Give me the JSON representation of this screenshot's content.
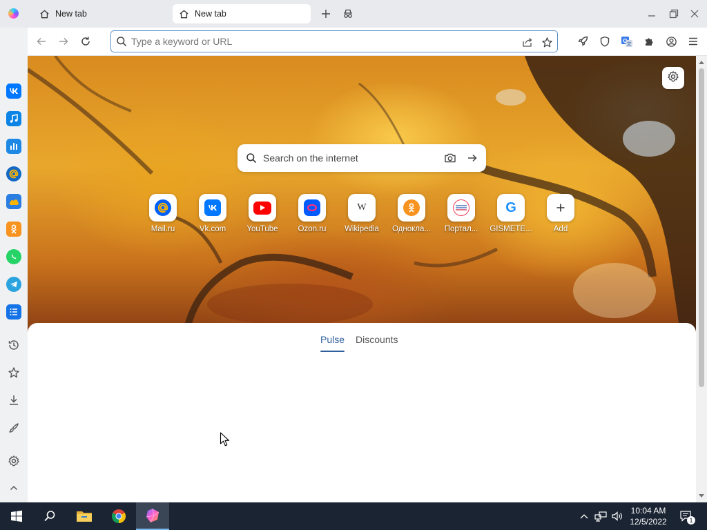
{
  "tabs": [
    {
      "label": "New tab",
      "icon": "home-icon",
      "active": false
    },
    {
      "label": "New tab",
      "icon": "home-icon",
      "active": true
    }
  ],
  "titlebar_icons": [
    "browser-logo-icon",
    "new-tab-icon",
    "incognito-icon",
    "minimize-icon",
    "restore-icon",
    "close-icon"
  ],
  "address_bar": {
    "placeholder": "Type a keyword or URL",
    "value": ""
  },
  "toolbar_icons": [
    "back-icon",
    "forward-icon",
    "reload-icon",
    "search-icon",
    "share-icon",
    "bookmark-star-icon",
    "rocket-icon",
    "shield-icon",
    "translate-icon",
    "extensions-icon",
    "profile-icon",
    "menu-icon"
  ],
  "sidebar": {
    "apps": [
      {
        "name": "VK",
        "icon": "vk-icon",
        "color": "#0077ff"
      },
      {
        "name": "Music",
        "icon": "music-icon",
        "color": "#0b84e6"
      },
      {
        "name": "Stats",
        "icon": "chart-icon",
        "color": "#1e88e5"
      },
      {
        "name": "Mail",
        "icon": "mail-at-icon",
        "color": "#1268c4"
      },
      {
        "name": "Cloud",
        "icon": "cloud-icon",
        "color": "#2a7de1"
      },
      {
        "name": "Odnoklassniki",
        "icon": "ok-icon",
        "color": "#f7931e"
      },
      {
        "name": "WhatsApp",
        "icon": "whatsapp-icon",
        "color": "#25d366"
      },
      {
        "name": "Telegram",
        "icon": "telegram-icon",
        "color": "#2aa3df"
      },
      {
        "name": "Notes",
        "icon": "list-icon",
        "color": "#1473e6"
      }
    ],
    "tools": [
      "history-icon",
      "bookmarks-star-icon",
      "downloads-icon",
      "extensions-brush-icon",
      "settings-gear-icon",
      "collapse-chevron-up-icon"
    ]
  },
  "search": {
    "placeholder": "Search on the internet"
  },
  "speed_dial": [
    {
      "label": "Mail.ru",
      "icon": "mailru-icon",
      "color": "#005ff9"
    },
    {
      "label": "Vk.com",
      "icon": "vk-icon",
      "color": "#0077ff"
    },
    {
      "label": "YouTube",
      "icon": "youtube-icon",
      "color": "#ff0000"
    },
    {
      "label": "Ozon.ru",
      "icon": "ozon-icon",
      "color": "#005bff"
    },
    {
      "label": "Wikipedia",
      "icon": "wikipedia-icon",
      "color": "#333333"
    },
    {
      "label": "Однокла...",
      "icon": "odnoklassniki-icon",
      "color": "#f7931e"
    },
    {
      "label": "Портал...",
      "icon": "gosuslugi-icon",
      "color": "#ee3f58"
    },
    {
      "label": "GISMETE...",
      "icon": "gismeteo-icon",
      "color": "#1e90ff"
    },
    {
      "label": "Add",
      "icon": "plus-icon",
      "color": "#333333"
    }
  ],
  "feed_tabs": [
    {
      "label": "Pulse",
      "active": true
    },
    {
      "label": "Discounts",
      "active": false
    }
  ],
  "taskbar": {
    "apps": [
      "windows-start-icon",
      "search-icon",
      "file-explorer-icon",
      "chrome-icon",
      "atom-browser-icon"
    ],
    "tray": [
      "chevron-up-icon",
      "network-icon",
      "volume-icon"
    ],
    "time": "10:04 AM",
    "date": "12/5/2022",
    "notifications": "1"
  }
}
